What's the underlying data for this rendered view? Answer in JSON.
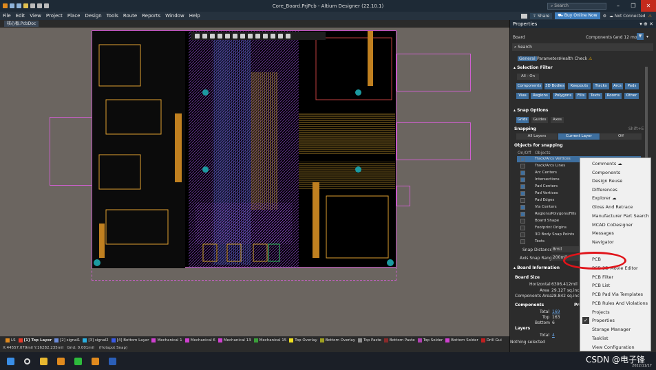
{
  "window": {
    "title": "Core_Board.PrjPcb - Altium Designer (22.10.1)",
    "search_placeholder": "Search"
  },
  "menu": [
    "File",
    "Edit",
    "View",
    "Project",
    "Place",
    "Design",
    "Tools",
    "Route",
    "Reports",
    "Window",
    "Help"
  ],
  "top_right": {
    "share": "Share",
    "buy": "Buy Online Now",
    "connection": "Not Connected"
  },
  "doc_tab": "核心板.PcbDoc",
  "properties": {
    "header": "Properties",
    "board_label": "Board",
    "board_filter": "Components (and 12 more)",
    "search_placeholder": "Search",
    "tabs": [
      "General",
      "Parameters",
      "Health Check"
    ],
    "selection_filter": {
      "title": "Selection Filter",
      "all_on": "All - On",
      "objects": [
        "Components",
        "3D Bodies",
        "Keepouts",
        "Tracks",
        "Arcs",
        "Pads",
        "Vias",
        "Regions",
        "Polygons",
        "Fills",
        "Texts",
        "Rooms",
        "Other"
      ]
    },
    "snap_options": {
      "title": "Snap Options",
      "buttons": [
        "Grids",
        "Guides",
        "Axes"
      ],
      "snapping_label": "Snapping",
      "snapping_shortcut": "Shift+E",
      "snapping_modes": [
        "All Layers",
        "Current Layer",
        "Off"
      ],
      "objects_title": "Objects for snapping",
      "col_onoff": "On/Off",
      "col_objects": "Objects",
      "items": [
        {
          "label": "Track/Arcs Vertices",
          "on": true
        },
        {
          "label": "Track/Arcs Lines",
          "on": false
        },
        {
          "label": "Arc Centers",
          "on": true
        },
        {
          "label": "Intersections",
          "on": true
        },
        {
          "label": "Pad Centers",
          "on": true
        },
        {
          "label": "Pad Vertices",
          "on": true
        },
        {
          "label": "Pad Edges",
          "on": false
        },
        {
          "label": "Via Centers",
          "on": true
        },
        {
          "label": "Regions/Polygons/Fills",
          "on": true
        },
        {
          "label": "Board Shape",
          "on": false
        },
        {
          "label": "Footprint Origins",
          "on": false
        },
        {
          "label": "3D Body Snap Points",
          "on": false
        },
        {
          "label": "Texts",
          "on": false
        }
      ],
      "snap_distance_label": "Snap Distance",
      "snap_distance_value": "8mil",
      "axis_snap_label": "Axis Snap Range",
      "axis_snap_value": "200mil"
    },
    "board_info": {
      "title": "Board Information",
      "size_title": "Board Size",
      "horizontal_label": "Horizontal",
      "horizontal_value": "6306.412mil",
      "area_label": "Area",
      "area_value": "29.127 sq.inch",
      "comp_area_label": "Components Area",
      "comp_area_value": "28.842 sq.inch",
      "components_title": "Components",
      "pri_label": "Pri",
      "total_label": "Total",
      "total_value": "169",
      "top_label": "Top",
      "top_value": "163",
      "bottom_label": "Bottom",
      "bottom_value": "6",
      "layers_title": "Layers",
      "layers_total_label": "Total",
      "layers_total_value": "4"
    },
    "status": "Nothing selected"
  },
  "context_menu": {
    "items": [
      "Comments",
      "Components",
      "Design Reuse",
      "Differences",
      "Explorer",
      "Gloss And Retrace",
      "Manufacturer Part Search",
      "MCAD CoDesigner",
      "Messages",
      "Navigator",
      "PCB",
      "PCB 3D Movie Editor",
      "PCB Filter",
      "PCB List",
      "PCB Pad Via Templates",
      "PCB Rules And Violations",
      "Projects",
      "Properties",
      "Storage Manager",
      "Tasklist",
      "View Configuration"
    ],
    "checked": "Properties"
  },
  "layers": [
    {
      "label": "LS",
      "color": "#e08a1e"
    },
    {
      "label": "[1] Top Layer",
      "color": "#e83a2a"
    },
    {
      "label": "[2] signal1",
      "color": "#6a8ad8"
    },
    {
      "label": "[3] signal2",
      "color": "#2ab0e0"
    },
    {
      "label": "[4] Bottom Layer",
      "color": "#3a5ae8"
    },
    {
      "label": "Mechanical 1",
      "color": "#d040d0"
    },
    {
      "label": "Mechanical 6",
      "color": "#d040d0"
    },
    {
      "label": "Mechanical 13",
      "color": "#d040d0"
    },
    {
      "label": "Mechanical 15",
      "color": "#3aa03a"
    },
    {
      "label": "Top Overlay",
      "color": "#f0e020"
    },
    {
      "label": "Bottom Overlay",
      "color": "#a0a020"
    },
    {
      "label": "Top Paste",
      "color": "#909090"
    },
    {
      "label": "Bottom Paste",
      "color": "#8a2a2a"
    },
    {
      "label": "Top Solder",
      "color": "#b040b0"
    },
    {
      "label": "Bottom Solder",
      "color": "#d040d0"
    },
    {
      "label": "Drill Gui",
      "color": "#c02020"
    }
  ],
  "statusbar": {
    "coords": "X:44557.079mil Y:16282.235mil",
    "grid": "Grid: 0.001mil",
    "snap": "(Hotspot Snap)"
  },
  "watermark": "CSDN @电子锋",
  "watermark_date": "2022/11/17",
  "colors": {
    "accent": "#3e6f9f",
    "annotation": "#e0141a"
  }
}
